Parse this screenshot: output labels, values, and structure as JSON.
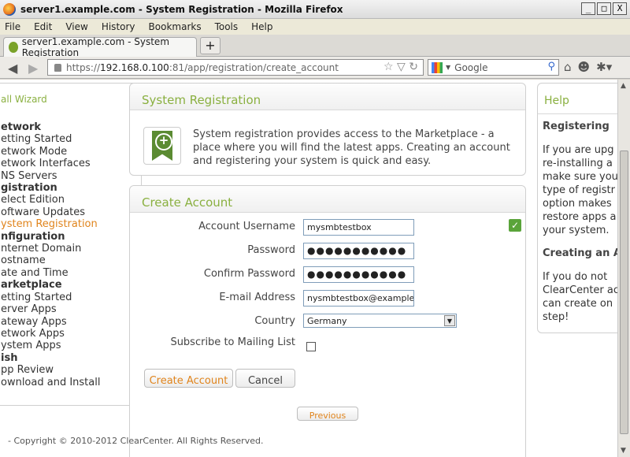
{
  "window": {
    "title": "server1.example.com - System Registration - Mozilla Firefox",
    "controls": [
      "_",
      "□",
      "X"
    ]
  },
  "menu": [
    "File",
    "Edit",
    "View",
    "History",
    "Bookmarks",
    "Tools",
    "Help"
  ],
  "tab": {
    "label": "server1.example.com - System Registration",
    "new_tab": "+"
  },
  "address": {
    "prefix": "https://",
    "host": "192.168.0.100",
    "rest": ":81/app/registration/create_account"
  },
  "search": {
    "placeholder": "Google"
  },
  "wizard": {
    "title": "all Wizard",
    "items": [
      {
        "text": "etwork",
        "kind": "sec"
      },
      {
        "text": "etting Started",
        "kind": "item"
      },
      {
        "text": "etwork Mode",
        "kind": "item"
      },
      {
        "text": "etwork Interfaces",
        "kind": "item"
      },
      {
        "text": "NS Servers",
        "kind": "item"
      },
      {
        "text": "gistration",
        "kind": "sec"
      },
      {
        "text": "elect Edition",
        "kind": "item"
      },
      {
        "text": "oftware Updates",
        "kind": "item"
      },
      {
        "text": "ystem Registration",
        "kind": "active"
      },
      {
        "text": "nfiguration",
        "kind": "sec"
      },
      {
        "text": "nternet Domain",
        "kind": "item"
      },
      {
        "text": "ostname",
        "kind": "item"
      },
      {
        "text": "ate and Time",
        "kind": "item"
      },
      {
        "text": "arketplace",
        "kind": "sec"
      },
      {
        "text": "etting Started",
        "kind": "item"
      },
      {
        "text": "erver Apps",
        "kind": "item"
      },
      {
        "text": "ateway Apps",
        "kind": "item"
      },
      {
        "text": "etwork Apps",
        "kind": "item"
      },
      {
        "text": "ystem Apps",
        "kind": "item"
      },
      {
        "text": "ish",
        "kind": "sec"
      },
      {
        "text": "pp Review",
        "kind": "item"
      },
      {
        "text": "ownload and Install",
        "kind": "item"
      }
    ]
  },
  "system_registration": {
    "title": "System Registration",
    "description": "System registration provides access to the Marketplace - a place where you will find the latest apps. Creating an account and registering your system is quick and easy."
  },
  "create_account": {
    "title": "Create Account",
    "labels": {
      "username": "Account Username",
      "password": "Password",
      "confirm": "Confirm Password",
      "email": "E-mail Address",
      "country": "Country",
      "subscribe": "Subscribe to Mailing List"
    },
    "values": {
      "username": "mysmbtestbox",
      "password": "●●●●●●●●●●●",
      "confirm": "●●●●●●●●●●●",
      "email": "nysmbtestbox@example.com",
      "country": "Germany"
    },
    "buttons": {
      "create": "Create Account",
      "cancel": "Cancel"
    }
  },
  "previous_button": "Previous",
  "help": {
    "title": "Help",
    "heading1": "Registering",
    "para1_lines": [
      "If you are upg",
      "re-installing a",
      "make sure you",
      "type of registr",
      "option makes",
      "restore apps a",
      "your system."
    ],
    "heading2": "Creating an A",
    "para2_lines": [
      "If you do not",
      "ClearCenter ac",
      "can create on",
      "step!"
    ]
  },
  "footer": "- Copyright © 2010-2012 ClearCenter. All Rights Reserved."
}
